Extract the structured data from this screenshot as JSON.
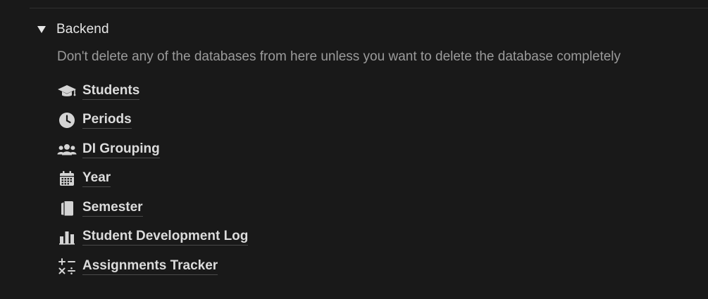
{
  "toggle": {
    "title": "Backend",
    "expanded": true
  },
  "note": "Don't delete any of the databases from here unless you want to delete the database completely",
  "databases": [
    {
      "label": "Students",
      "icon": "graduation-cap-icon"
    },
    {
      "label": "Periods",
      "icon": "clock-icon"
    },
    {
      "label": "DI Grouping",
      "icon": "users-icon"
    },
    {
      "label": "Year",
      "icon": "calendar-icon"
    },
    {
      "label": "Semester",
      "icon": "copy-icon"
    },
    {
      "label": "Student Development Log",
      "icon": "bar-chart-icon"
    },
    {
      "label": "Assignments Tracker",
      "icon": "math-operators-icon"
    }
  ],
  "colors": {
    "background": "#191919",
    "text": "#dcdcdc",
    "muted_text": "#9b9b9b",
    "divider": "#2f2f2f"
  }
}
